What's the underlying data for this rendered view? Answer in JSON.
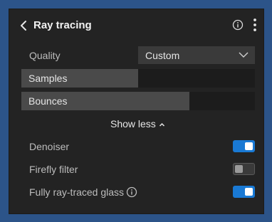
{
  "header": {
    "title": "Ray tracing"
  },
  "quality": {
    "label": "Quality",
    "selected": "Custom"
  },
  "sliders": [
    {
      "label": "Samples",
      "level_percent": 50
    },
    {
      "label": "Bounces",
      "level_percent": 72
    }
  ],
  "show_less": {
    "label": "Show less"
  },
  "toggles": [
    {
      "label": "Denoiser",
      "state": "on"
    },
    {
      "label": "Firefly filter",
      "state": "off"
    },
    {
      "label": "Fully ray-traced glass",
      "state": "on"
    }
  ],
  "colors": {
    "accent": "#1979d4",
    "panel_background": "#232323",
    "page_background": "#2c5489"
  },
  "icons": [
    "chevron-left-icon",
    "info-icon",
    "more-vertical-icon",
    "chevron-down-icon",
    "chevron-up-icon"
  ]
}
